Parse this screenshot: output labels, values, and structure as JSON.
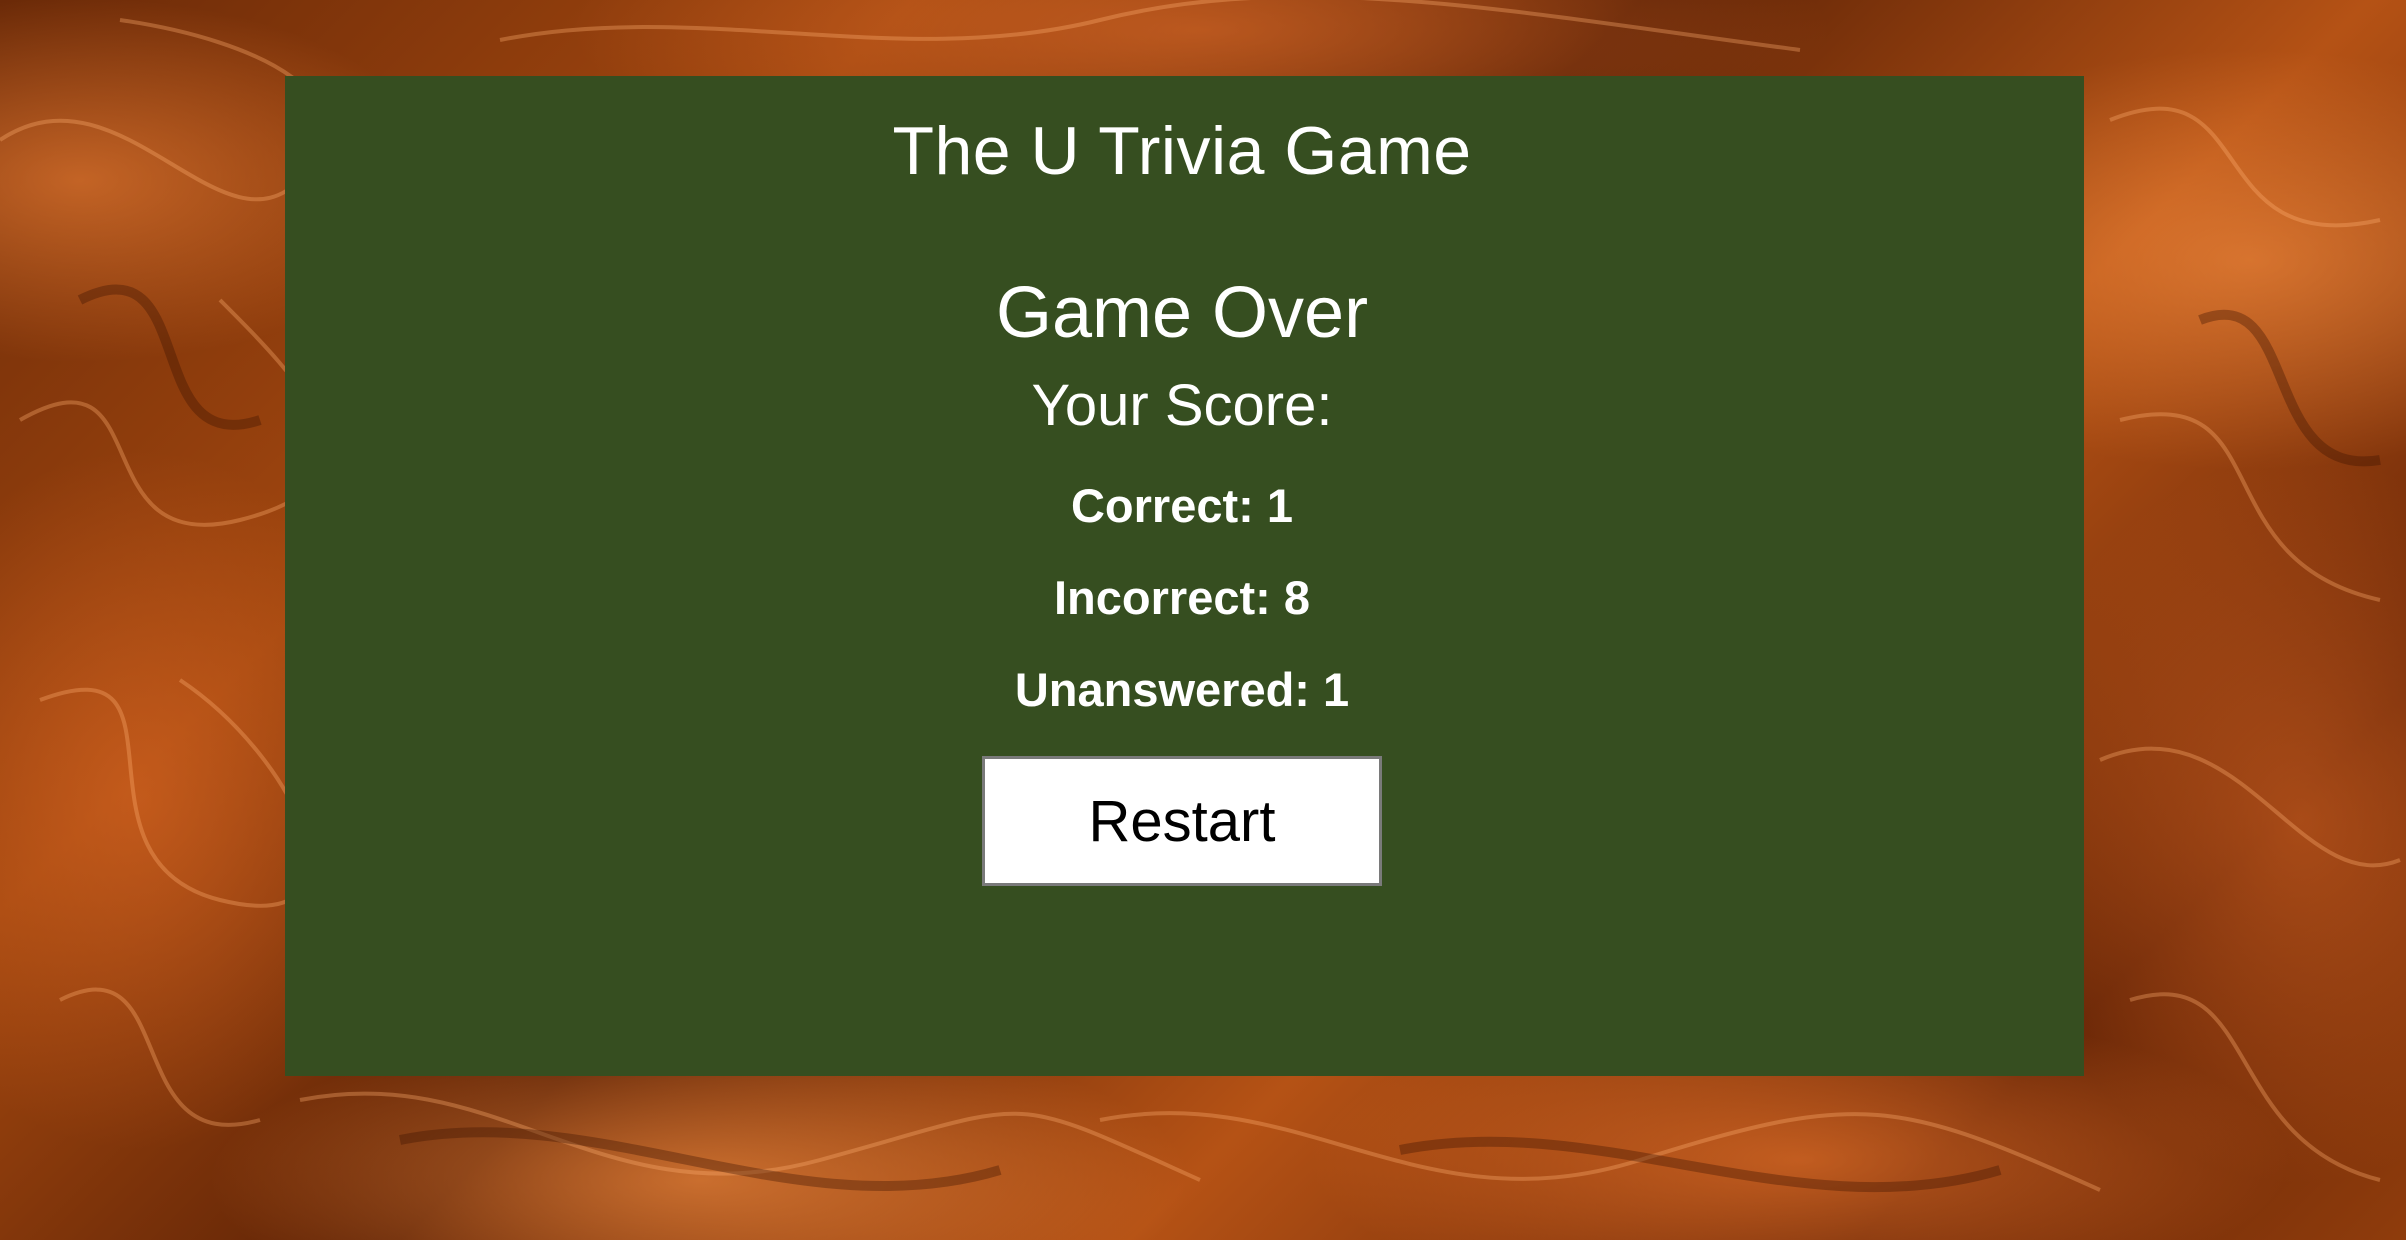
{
  "background": {
    "theme": "orange-flame-smoke",
    "base_color": "#a2470f"
  },
  "panel": {
    "background_color": "#364e20",
    "title": "The U Trivia Game",
    "game_over": "Game Over",
    "your_score": "Your Score:",
    "stats": {
      "correct": "Correct: 1",
      "incorrect": "Incorrect: 8",
      "unanswered": "Unanswered: 1"
    },
    "restart_label": "Restart"
  }
}
